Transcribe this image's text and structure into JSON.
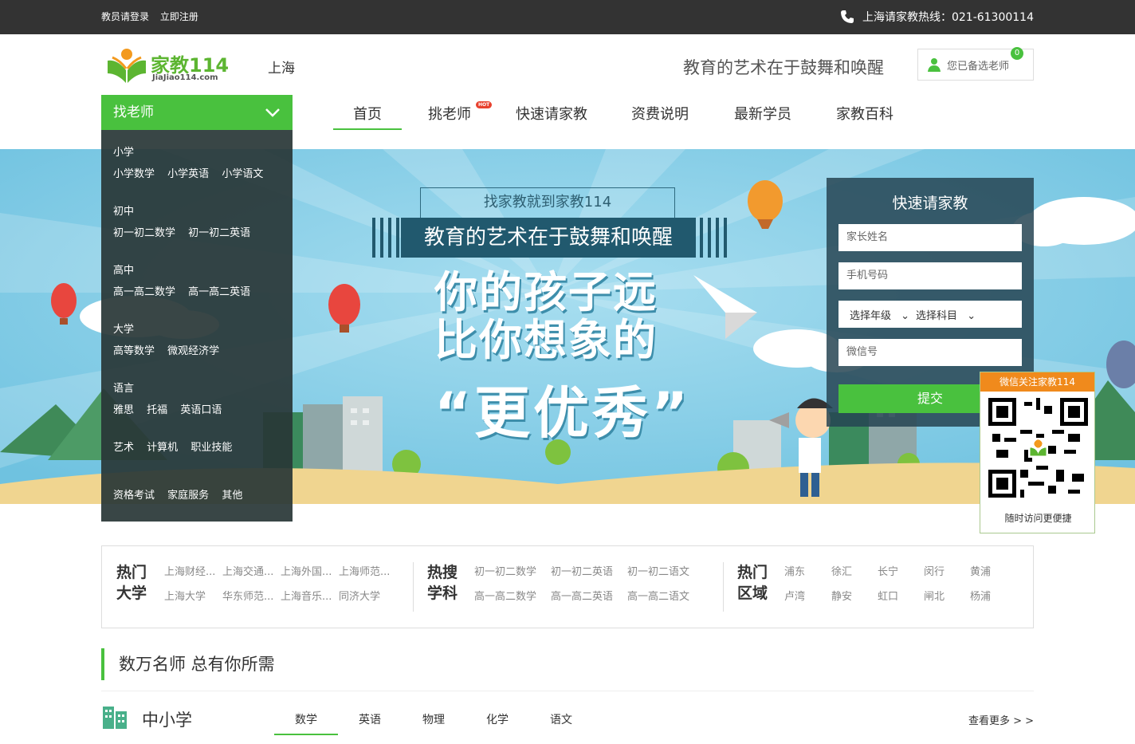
{
  "topbar": {
    "login": "教员请登录",
    "register": "立即注册",
    "hotline": "上海请家教热线：021-61300114"
  },
  "header": {
    "logo_name": "家教114",
    "logo_domain": "JiaJiao114.com",
    "city": "上海",
    "slogan": "教育的艺术在于鼓舞和唤醒",
    "selected_label": "您已备选老师",
    "selected_count": "0"
  },
  "nav": {
    "items": [
      "首页",
      "挑老师",
      "快速请家教",
      "资费说明",
      "最新学员",
      "家教百科"
    ],
    "hot_badge": "HOT",
    "category_label": "找老师"
  },
  "categories": [
    {
      "title": "小学",
      "items": [
        "小学数学",
        "小学英语",
        "小学语文"
      ]
    },
    {
      "title": "初中",
      "items": [
        "初一初二数学",
        "初一初二英语"
      ]
    },
    {
      "title": "高中",
      "items": [
        "高一高二数学",
        "高一高二英语"
      ]
    },
    {
      "title": "大学",
      "items": [
        "高等数学",
        "微观经济学"
      ]
    },
    {
      "title": "语言",
      "items": [
        "雅思",
        "托福",
        "英语口语"
      ]
    },
    {
      "title": "",
      "items": [
        "艺术",
        "计算机",
        "职业技能"
      ]
    },
    {
      "title": "",
      "items": [
        "资格考试",
        "家庭服务",
        "其他"
      ]
    }
  ],
  "banner": {
    "head": "找家教就到家教114",
    "title": "教育的艺术在于鼓舞和唤醒",
    "line1": "你的孩子远",
    "line2": "比你想象的",
    "line3": "“更优秀”"
  },
  "quick_form": {
    "title": "快速请家教",
    "parent_name_placeholder": "家长姓名",
    "phone_placeholder": "手机号码",
    "grade_select": "选择年级",
    "subject_select": "选择科目",
    "wechat_placeholder": "微信号",
    "submit": "提交"
  },
  "qr": {
    "title": "微信关注家教114",
    "footer": "随时访问更便捷"
  },
  "hot": {
    "universities_label": "热门大学",
    "universities": [
      [
        "上海财经...",
        "上海交通...",
        "上海外国...",
        "上海师范..."
      ],
      [
        "上海大学",
        "华东师范...",
        "上海音乐...",
        "同济大学"
      ]
    ],
    "subjects_label": "热搜学科",
    "subjects": [
      [
        "初一初二数学",
        "初一初二英语",
        "初一初二语文"
      ],
      [
        "高一高二数学",
        "高一高二英语",
        "高一高二语文"
      ]
    ],
    "districts_label": "热门区域",
    "districts": [
      [
        "浦东",
        "徐汇",
        "长宁",
        "闵行",
        "黄浦"
      ],
      [
        "卢湾",
        "静安",
        "虹口",
        "闸北",
        "杨浦"
      ]
    ]
  },
  "section": {
    "title": "数万名师 总有你所需",
    "sub_title": "中小学",
    "tabs": [
      "数学",
      "英语",
      "物理",
      "化学",
      "语文"
    ],
    "more": "查看更多 > >"
  },
  "colors": {
    "brand_green": "#49c13e",
    "topbar": "#333333",
    "sky": "#7ecbe6",
    "qr_orange": "#f08a1c"
  }
}
